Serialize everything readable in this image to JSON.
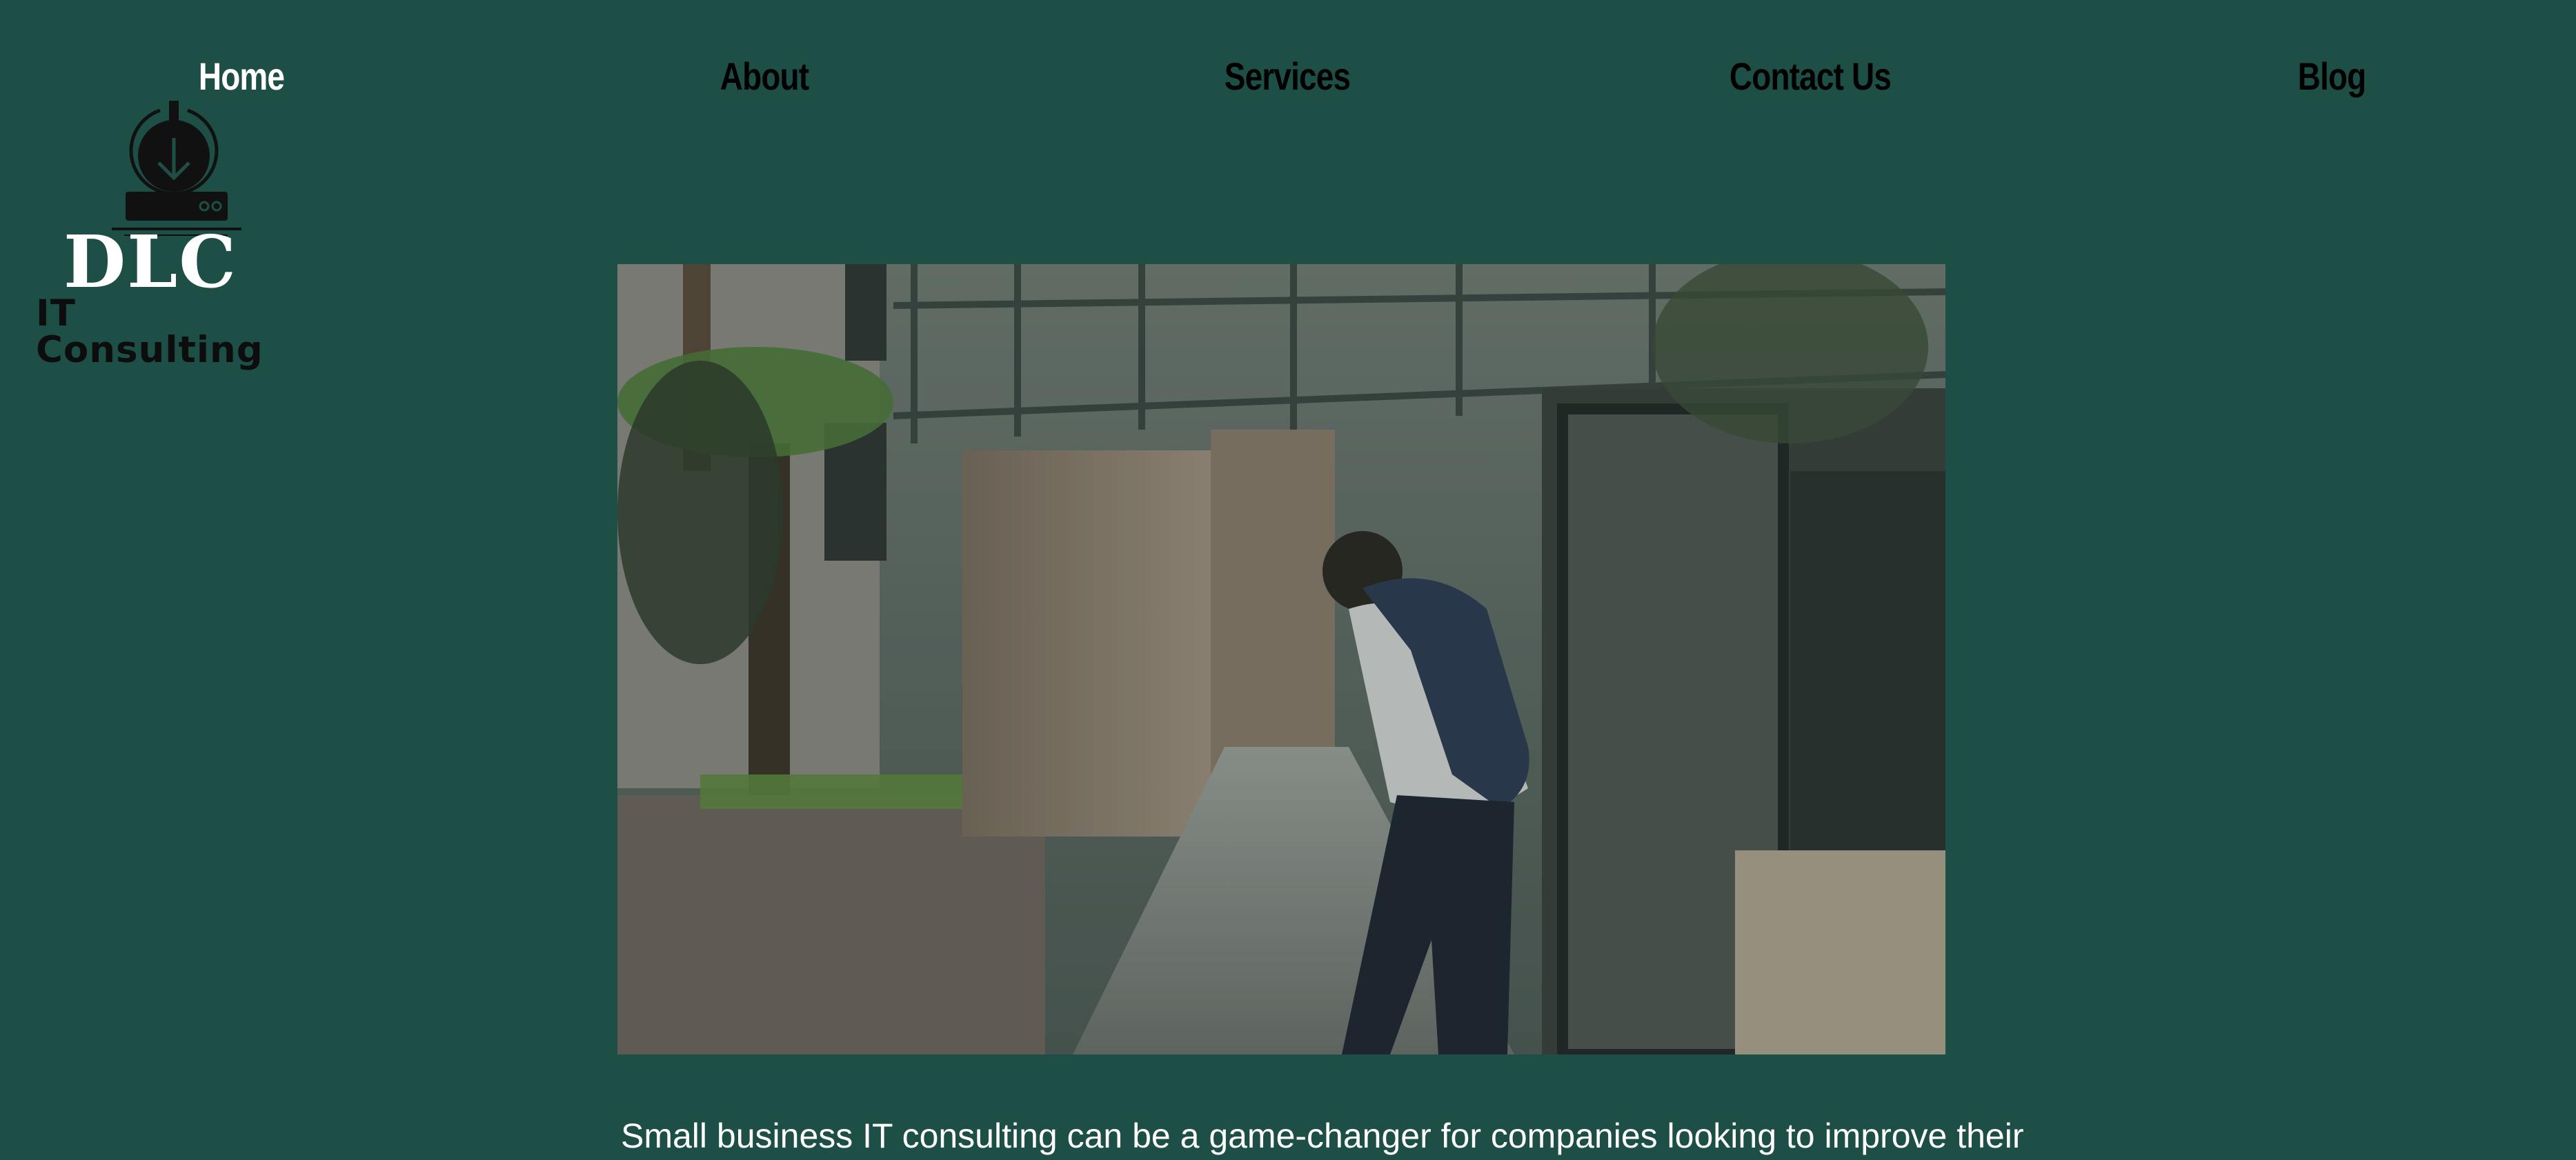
{
  "nav": {
    "items": [
      {
        "label": "Home",
        "active": true
      },
      {
        "label": "About",
        "active": false
      },
      {
        "label": "Services",
        "active": false
      },
      {
        "label": "Contact Us",
        "active": false
      },
      {
        "label": "Blog",
        "active": false
      }
    ]
  },
  "logo": {
    "name": "DLC",
    "subtitle": "IT Consulting",
    "icon": "download-server-icon"
  },
  "hero": {
    "media": "video-person-walking-icon"
  },
  "intro": {
    "text": "Small business IT consulting can be a game-changer for companies looking to improve their"
  },
  "colors": {
    "background": "#1d4f47",
    "nav_text": "#000000",
    "nav_active": "#ffffff",
    "logo_text": "#ffffff",
    "body_text": "#ffffff"
  }
}
